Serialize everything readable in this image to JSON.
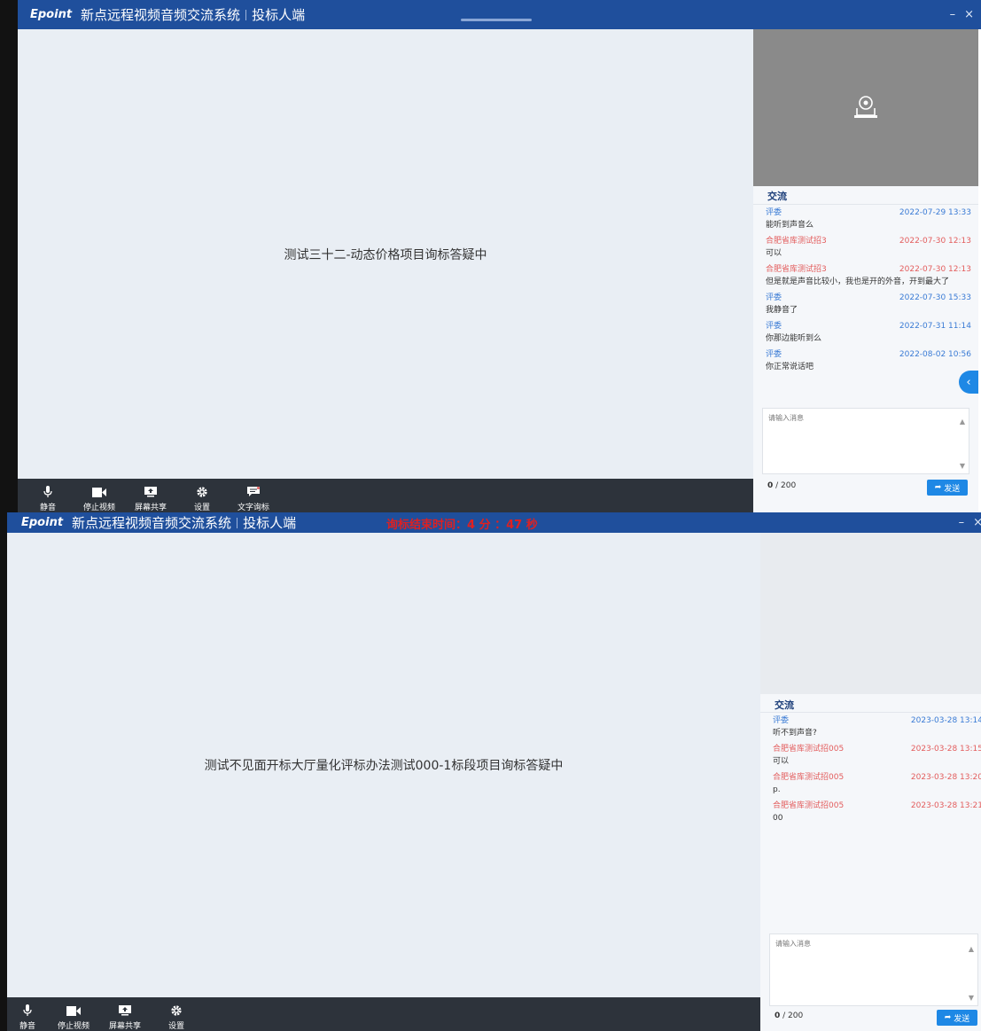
{
  "window1": {
    "logo": "Epoint",
    "app_title": "新点远程视频音频交流系统",
    "role": "投标人端",
    "minimize": "–",
    "close": "×",
    "stage_text": "测试三十二-动态价格项目询标答疑中",
    "toolbar": [
      {
        "label": "静音",
        "icon": "microphone-icon"
      },
      {
        "label": "停止视频",
        "icon": "video-camera-icon"
      },
      {
        "label": "屏幕共享",
        "icon": "screen-share-icon"
      },
      {
        "label": "设置",
        "icon": "gear-icon"
      },
      {
        "label": "文字询标",
        "icon": "chat-icon"
      }
    ],
    "chat": {
      "title": "交流",
      "messages": [
        {
          "sender": "评委",
          "type": "judge",
          "time": "2022-07-29 13:33",
          "text": "能听到声音么"
        },
        {
          "sender": "合肥省库测试招3",
          "type": "bidder",
          "time": "2022-07-30 12:13",
          "text": "可以"
        },
        {
          "sender": "合肥省库测试招3",
          "type": "bidder",
          "time": "2022-07-30 12:13",
          "text": "但是就是声音比较小，我也是开的外音，开到最大了"
        },
        {
          "sender": "评委",
          "type": "judge",
          "time": "2022-07-30 15:33",
          "text": "我静音了"
        },
        {
          "sender": "评委",
          "type": "judge",
          "time": "2022-07-31 11:14",
          "text": "你那边能听到么"
        },
        {
          "sender": "评委",
          "type": "judge",
          "time": "2022-08-02 10:56",
          "text": "你正常说话吧"
        }
      ],
      "placeholder": "请输入消息",
      "count_current": "0",
      "count_max": " / 200",
      "send_label": "发送",
      "collapse": "‹"
    }
  },
  "window2": {
    "logo": "Epoint",
    "app_title": "新点远程视频音频交流系统",
    "role": "投标人端",
    "timer": "询标结束时间：4 分 ：47 秒",
    "minimize": "–",
    "close": "×",
    "stage_text": "测试不见面开标大厅量化评标办法测试000-1标段项目询标答疑中",
    "toolbar": [
      {
        "label": "静音",
        "icon": "microphone-icon"
      },
      {
        "label": "停止视频",
        "icon": "video-camera-icon"
      },
      {
        "label": "屏幕共享",
        "icon": "screen-share-icon"
      },
      {
        "label": "设置",
        "icon": "gear-icon"
      }
    ],
    "chat": {
      "title": "交流",
      "messages": [
        {
          "sender": "评委",
          "type": "judge",
          "time": "2023-03-28 13:14",
          "text": "听不到声音?"
        },
        {
          "sender": "合肥省库测试招005",
          "type": "bidder",
          "time": "2023-03-28 13:15",
          "text": "可以"
        },
        {
          "sender": "合肥省库测试招005",
          "type": "bidder",
          "time": "2023-03-28 13:20",
          "text": "p."
        },
        {
          "sender": "合肥省库测试招005",
          "type": "bidder",
          "time": "2023-03-28 13:21",
          "text": "00"
        }
      ],
      "placeholder": "请输入消息",
      "count_current": "0",
      "count_max": " / 200",
      "send_label": "发送"
    }
  },
  "colors": {
    "titlebar": "#1f4f9c",
    "stage": "#e9eef4",
    "toolbar": "#2d333b",
    "accent": "#1e88e5",
    "judge": "#3a7bd5",
    "bidder": "#e35d5d",
    "timer": "#e02020"
  }
}
